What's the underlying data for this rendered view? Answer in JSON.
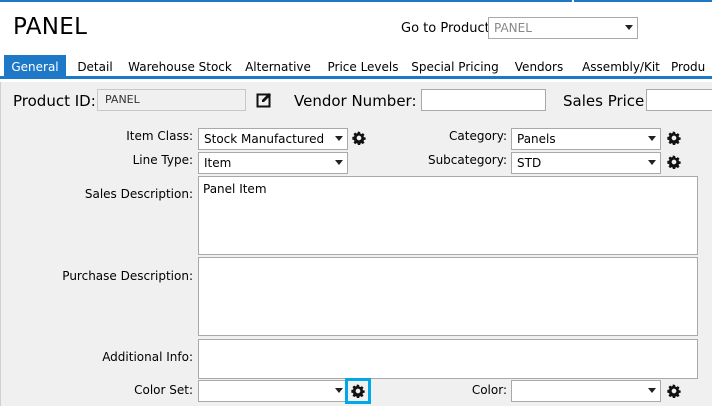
{
  "header": {
    "title": "PANEL",
    "goto_label": "Go to Product:",
    "goto_value": "PANEL"
  },
  "tabs": [
    "General",
    "Detail",
    "Warehouse Stock",
    "Alternative",
    "Price Levels",
    "Special Pricing",
    "Vendors",
    "Assembly/Kit",
    "Produ"
  ],
  "top_fields": {
    "product_id_label": "Product ID:",
    "product_id_value": "PANEL",
    "vendor_number_label": "Vendor Number:",
    "vendor_number_value": "",
    "sales_price_label": "Sales Price:",
    "sales_price_value": ""
  },
  "form": {
    "item_class_label": "Item Class:",
    "item_class_value": "Stock Manufactured Me",
    "line_type_label": "Line Type:",
    "line_type_value": "Item",
    "category_label": "Category:",
    "category_value": "Panels",
    "subcategory_label": "Subcategory:",
    "subcategory_value": "STD",
    "sales_description_label": "Sales Description:",
    "sales_description_value": "Panel Item",
    "purchase_description_label": "Purchase Description:",
    "purchase_description_value": "",
    "additional_info_label": "Additional Info:",
    "additional_info_value": "",
    "color_set_label": "Color Set:",
    "color_set_value": "",
    "color_label": "Color:",
    "color_value": ""
  },
  "colors": {
    "accent": "#1e78c8",
    "highlight": "#00a8e8"
  },
  "icons": [
    "gear-icon",
    "edit-icon",
    "chevron-down-icon"
  ]
}
